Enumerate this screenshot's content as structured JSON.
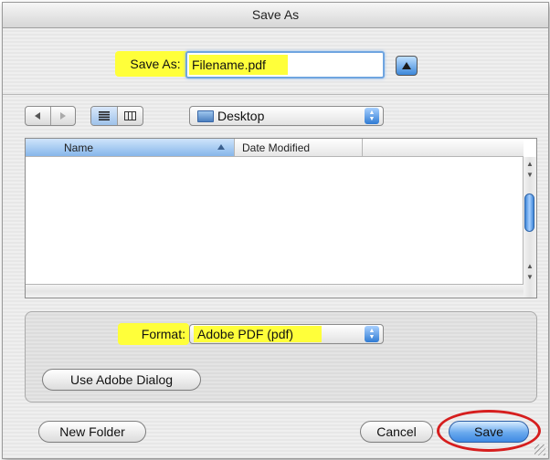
{
  "window": {
    "title": "Save As"
  },
  "save_row": {
    "label": "Save As:",
    "filename": "Filename.pdf",
    "expand_icon": "triangle-up-icon"
  },
  "browser": {
    "nav_back_icon": "back-arrow-icon",
    "nav_forward_icon": "forward-arrow-icon",
    "view_list_icon": "list-view-icon",
    "view_column_icon": "column-view-icon",
    "location": "Desktop",
    "columns": [
      "Name",
      "Date Modified"
    ],
    "sort_column": "Name"
  },
  "format_row": {
    "label": "Format:",
    "selected": "Adobe PDF (pdf)"
  },
  "buttons": {
    "use_adobe_dialog": "Use Adobe Dialog",
    "new_folder": "New Folder",
    "cancel": "Cancel",
    "save": "Save"
  },
  "colors": {
    "highlight": "#ffff3a",
    "accent": "#3f8ae3",
    "annotation_circle": "#d61e1e"
  }
}
